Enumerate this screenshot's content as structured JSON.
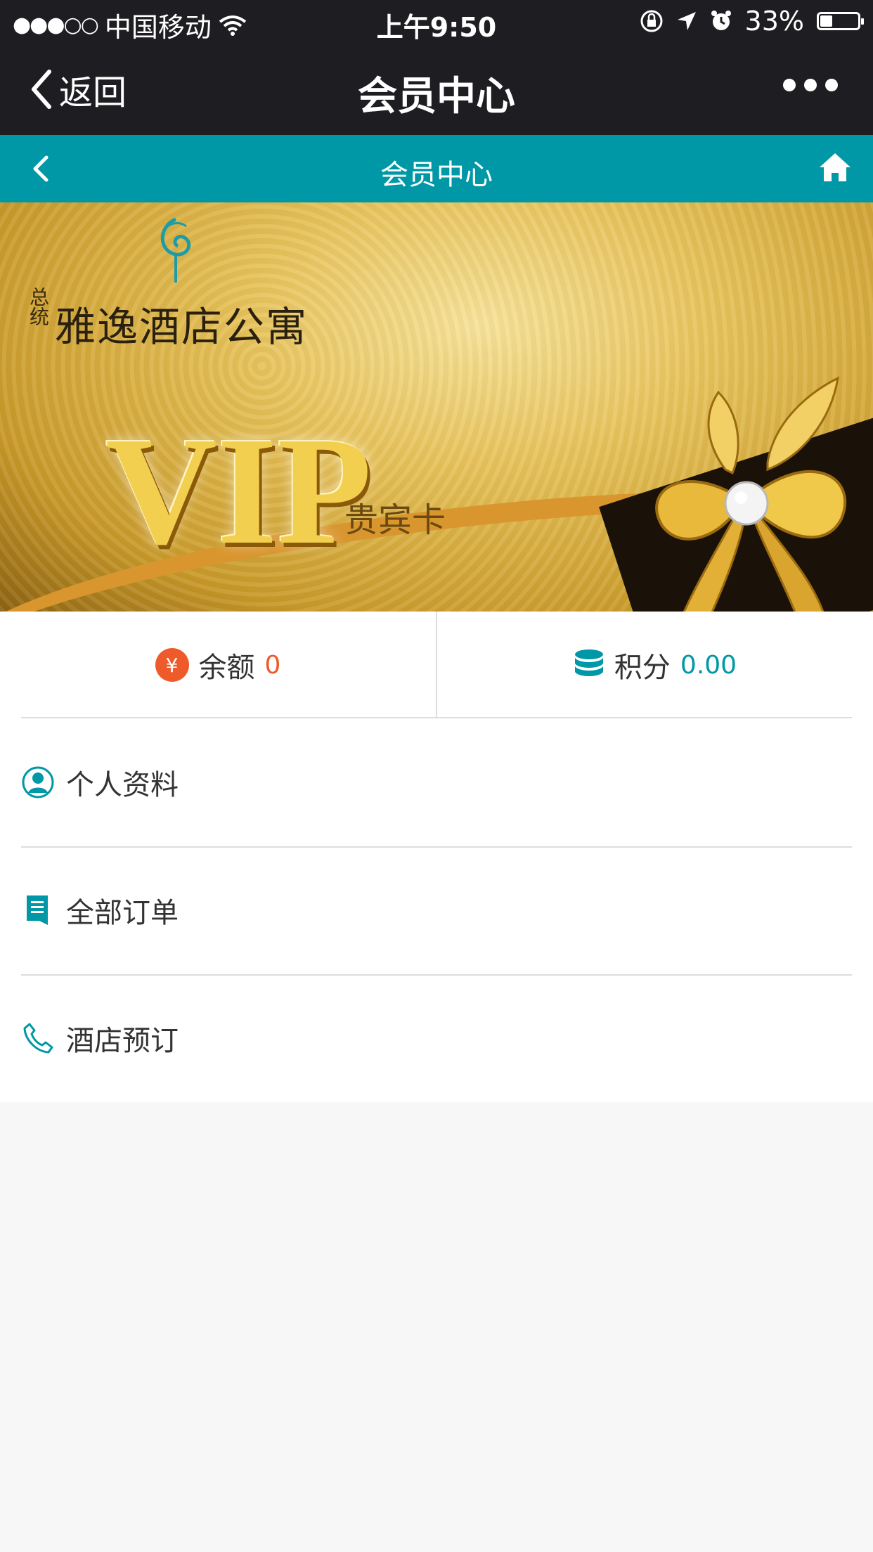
{
  "status_bar": {
    "signal": "●●●○○",
    "carrier": "中国移动",
    "time": "上午9:50",
    "battery_text": "33%",
    "battery_level": 0.33
  },
  "wechat_nav": {
    "back_label": "返回",
    "title": "会员中心"
  },
  "page_header": {
    "title": "会员中心"
  },
  "banner": {
    "hotel_prefix": "总统",
    "hotel_name": "雅逸酒店公寓",
    "vip_text": "VIP",
    "vip_subtitle": "贵宾卡"
  },
  "stats": {
    "balance_label": "余额",
    "balance_value": "0",
    "balance_icon_glyph": "¥",
    "points_label": "积分",
    "points_value": "0.00"
  },
  "menu": {
    "items": [
      {
        "label": "个人资料",
        "icon": "user-icon"
      },
      {
        "label": "全部订单",
        "icon": "document-icon"
      },
      {
        "label": "酒店预订",
        "icon": "phone-icon"
      }
    ]
  },
  "colors": {
    "teal": "#0098a6",
    "orange": "#ef5a2a",
    "dark_bar": "#1e1e22"
  }
}
